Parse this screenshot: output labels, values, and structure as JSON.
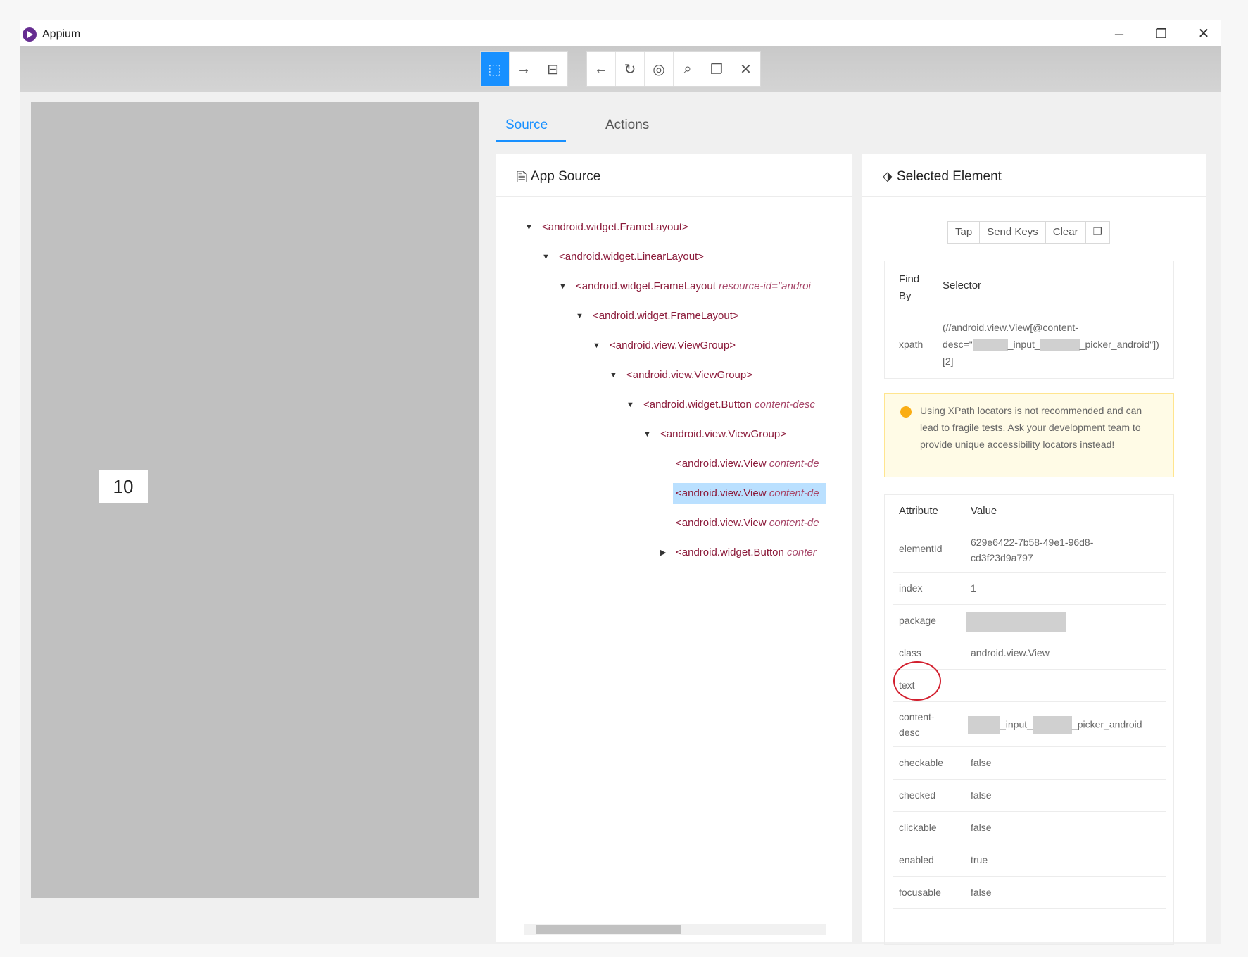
{
  "window": {
    "title": "Appium",
    "controls": {
      "minimize": "–",
      "restore": "❐",
      "close": "✕"
    }
  },
  "toolbar": {
    "group1": [
      {
        "icon": "select-element-icon",
        "glyph": "⬚"
      },
      {
        "icon": "swipe-icon",
        "glyph": "→"
      },
      {
        "icon": "tap-coordinates-icon",
        "glyph": "⊟"
      }
    ],
    "group2": [
      {
        "icon": "back-icon",
        "glyph": "←"
      },
      {
        "icon": "refresh-icon",
        "glyph": "↻"
      },
      {
        "icon": "eye-icon",
        "glyph": "◎"
      },
      {
        "icon": "search-icon",
        "glyph": "⌕"
      },
      {
        "icon": "copy-icon",
        "glyph": "❐"
      },
      {
        "icon": "close-icon",
        "glyph": "✕"
      }
    ]
  },
  "device": {
    "number_label": "10"
  },
  "tabs": {
    "source": "Source",
    "actions": "Actions"
  },
  "app_source": {
    "title": "App Source",
    "nodes": [
      {
        "tag": "<android.widget.FrameLayout>",
        "attr": ""
      },
      {
        "tag": "<android.widget.LinearLayout>",
        "attr": ""
      },
      {
        "tag": "<android.widget.FrameLayout ",
        "attr": "resource-id=\"androi"
      },
      {
        "tag": "<android.widget.FrameLayout>",
        "attr": ""
      },
      {
        "tag": "<android.view.ViewGroup>",
        "attr": ""
      },
      {
        "tag": "<android.view.ViewGroup>",
        "attr": ""
      },
      {
        "tag": "<android.widget.Button ",
        "attr": "content-desc"
      },
      {
        "tag": "<android.view.ViewGroup>",
        "attr": ""
      },
      {
        "tag": "<android.view.View ",
        "attr": "content-de"
      },
      {
        "tag": "<android.view.View ",
        "attr": "content-de"
      },
      {
        "tag": "<android.view.View ",
        "attr": "content-de"
      },
      {
        "tag": "<android.widget.Button ",
        "attr": "conter"
      }
    ]
  },
  "selected": {
    "title": "Selected Element",
    "buttons": {
      "tap": "Tap",
      "send_keys": "Send Keys",
      "clear": "Clear"
    },
    "selector_table": {
      "find_by_header": "Find By",
      "selector_header": "Selector",
      "find_by": "xpath",
      "selector_line1": "(//android.view.View[@content-",
      "selector_line2a": "desc=\"",
      "selector_line2b": "_input_",
      "selector_line2c": "_picker_android\"])",
      "selector_line3": "[2]"
    },
    "warning": "Using XPath locators is not recommended and can lead to fragile tests. Ask your development team to provide unique accessibility locators instead!",
    "attributes_header": {
      "name": "Attribute",
      "value": "Value"
    },
    "attributes": [
      {
        "name": "elementId",
        "value": "629e6422-7b58-49e1-96d8-cd3f23d9a797"
      },
      {
        "name": "index",
        "value": "1"
      },
      {
        "name": "package",
        "value": ""
      },
      {
        "name": "class",
        "value": "android.view.View"
      },
      {
        "name": "text",
        "value": ""
      },
      {
        "name": "content-desc",
        "value_mid": "_input_",
        "value_end": "_picker_android"
      },
      {
        "name": "checkable",
        "value": "false"
      },
      {
        "name": "checked",
        "value": "false"
      },
      {
        "name": "clickable",
        "value": "false"
      },
      {
        "name": "enabled",
        "value": "true"
      },
      {
        "name": "focusable",
        "value": "false"
      }
    ]
  }
}
